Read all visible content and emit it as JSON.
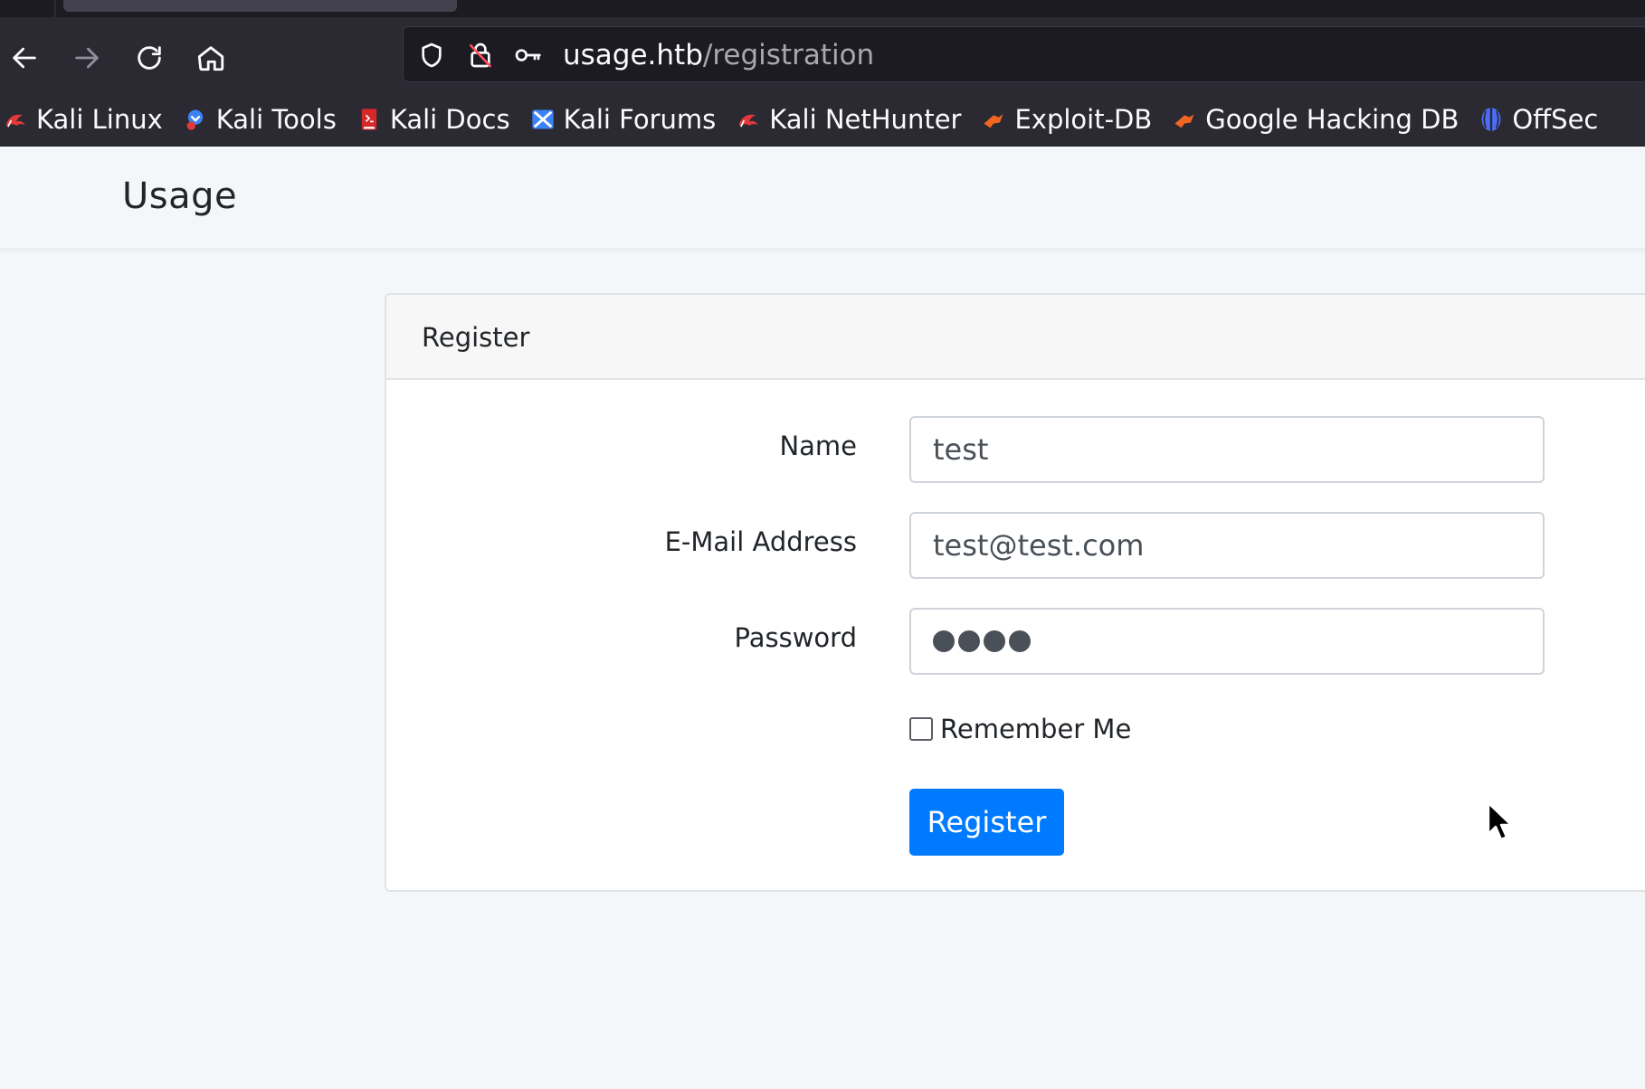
{
  "browser": {
    "url_host": "usage.htb",
    "url_path": "/registration",
    "nav_icons": [
      "back-icon",
      "forward-icon",
      "reload-icon",
      "home-icon"
    ],
    "urlbar_icons": [
      "shield-icon",
      "lock-insecure-icon",
      "key-icon"
    ],
    "bookmarks": [
      {
        "label": "Kali Linux",
        "icon": "kali-dragon-icon"
      },
      {
        "label": "Kali Tools",
        "icon": "kali-tools-icon"
      },
      {
        "label": "Kali Docs",
        "icon": "kali-docs-icon"
      },
      {
        "label": "Kali Forums",
        "icon": "kali-forums-icon"
      },
      {
        "label": "Kali NetHunter",
        "icon": "kali-nethunter-icon"
      },
      {
        "label": "Exploit-DB",
        "icon": "exploit-db-icon"
      },
      {
        "label": "Google Hacking DB",
        "icon": "ghdb-icon"
      },
      {
        "label": "OffSec",
        "icon": "offsec-icon"
      }
    ]
  },
  "page": {
    "brand": "Usage",
    "card_title": "Register",
    "fields": {
      "name": {
        "label": "Name",
        "value": "test"
      },
      "email": {
        "label": "E-Mail Address",
        "value": "test@test.com"
      },
      "password": {
        "label": "Password",
        "value_masked": "●●●●"
      }
    },
    "remember_label": "Remember Me",
    "remember_checked": false,
    "submit_label": "Register"
  },
  "colors": {
    "primary_button": "#007bff",
    "browser_toolbar": "#2b2a33",
    "page_background": "#f4f7f9"
  }
}
